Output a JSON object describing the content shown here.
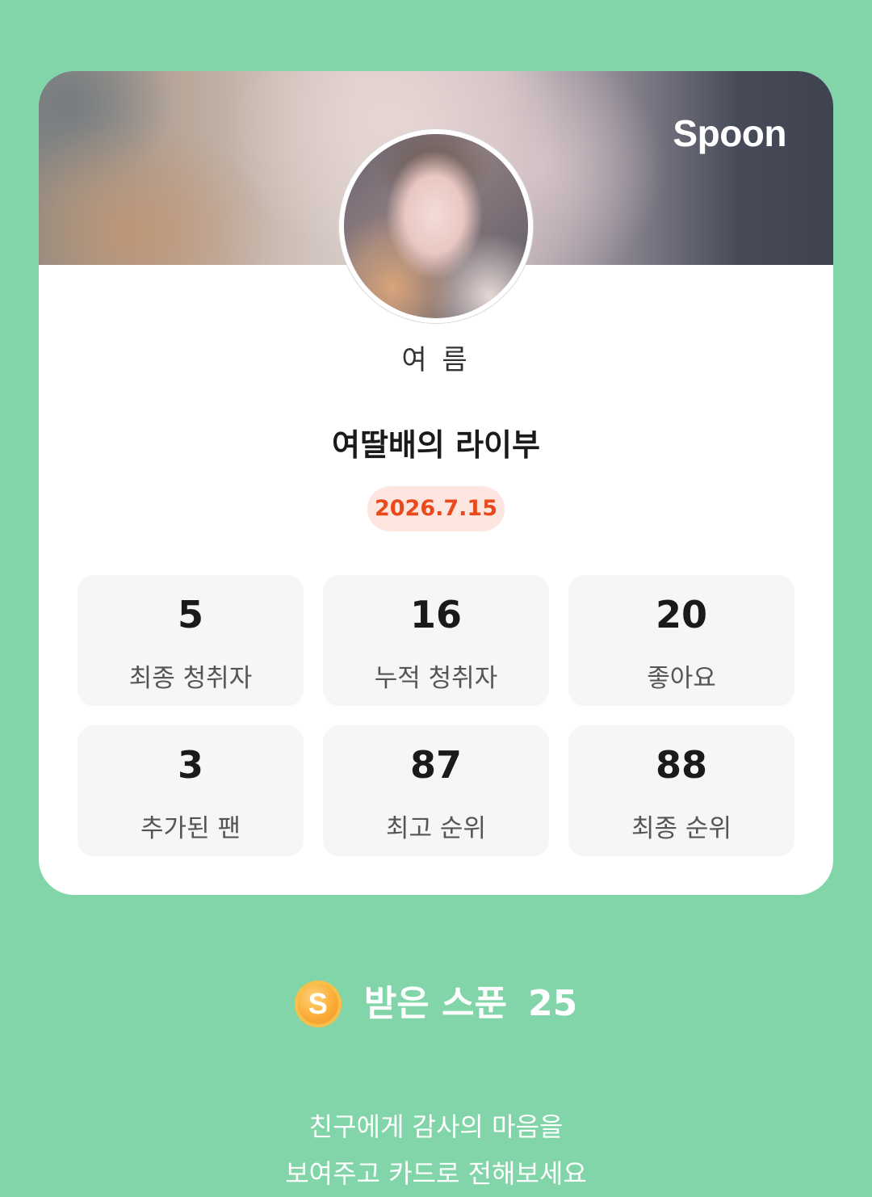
{
  "brand": "Spoon",
  "profile": {
    "nickname": "여 름",
    "avatar_icon": "profile-photo"
  },
  "live": {
    "title": "여딸배의 라이부",
    "date": "2026.7.15"
  },
  "stats": [
    {
      "value": "5",
      "label": "최종 청취자"
    },
    {
      "value": "16",
      "label": "누적 청취자"
    },
    {
      "value": "20",
      "label": "좋아요"
    },
    {
      "value": "3",
      "label": "추가된 팬"
    },
    {
      "value": "87",
      "label": "최고 순위"
    },
    {
      "value": "88",
      "label": "최종 순위"
    }
  ],
  "spoons": {
    "coin_icon": "spoon-coin-icon",
    "coin_letter": "S",
    "label": "받은 스푼",
    "count": "25"
  },
  "message": {
    "line1": "친구에게 감사의 마음을",
    "line2": "보여주고 카드로 전해보세요"
  },
  "colors": {
    "background": "#82d5a8",
    "card": "#ffffff",
    "date_text": "#e84a1c",
    "date_bg": "#fde6e0",
    "stat_bg": "#f6f6f6"
  }
}
